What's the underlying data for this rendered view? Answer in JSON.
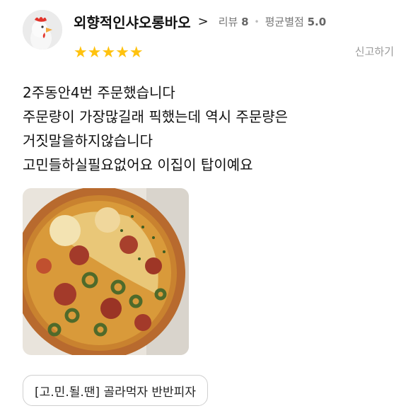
{
  "reviewer": {
    "name": "외향적인샤오롱바오",
    "review_count_label": "리뷰",
    "review_count": "8",
    "avg_score_label": "평균별점",
    "avg_score": "5.0"
  },
  "rating": {
    "stars": 5,
    "stars_display": "★★★★★"
  },
  "actions": {
    "report_label": "신고하기"
  },
  "review": {
    "lines": [
      "2주동안4번 주문했습니다",
      "주문량이 가장많길래 픽했는데 역시 주문량은",
      "거짓말을하지않습니다",
      "고민들하실필요없어요 이집이 탑이예요"
    ]
  },
  "menu_tag": {
    "label": "[고.민.될.땐] 골라먹자 반반피자"
  },
  "colors": {
    "star": "#ffc20e",
    "muted": "#9a9a9a"
  },
  "icons": {
    "chevron": "chevron-right-icon",
    "avatar": "chicken-avatar-icon"
  }
}
